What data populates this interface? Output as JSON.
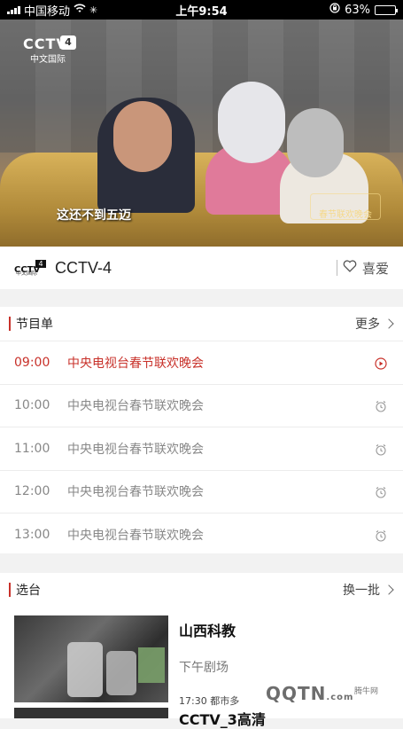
{
  "status_bar": {
    "carrier": "中国移动",
    "time": "上午9:54",
    "battery": "63%",
    "battery_level": 0.63
  },
  "video": {
    "channel_logo": "CCTV",
    "channel_number": "4",
    "channel_sub": "中文国际",
    "subtitle": "这还不到五迈",
    "stamp_text": "春节联欢晚会"
  },
  "channel_bar": {
    "logo_text": "CCTV",
    "logo_number": "4",
    "logo_sub": "中文国际",
    "name": "CCTV-4",
    "favorite_label": "喜爱"
  },
  "schedule": {
    "title": "节目单",
    "more_label": "更多",
    "items": [
      {
        "time": "09:00",
        "title": "中央电视台春节联欢晚会",
        "icon": "play-circle-icon",
        "active": true
      },
      {
        "time": "10:00",
        "title": "中央电视台春节联欢晚会",
        "icon": "alarm-icon",
        "active": false
      },
      {
        "time": "11:00",
        "title": "中央电视台春节联欢晚会",
        "icon": "alarm-icon",
        "active": false
      },
      {
        "time": "12:00",
        "title": "中央电视台春节联欢晚会",
        "icon": "alarm-icon",
        "active": false
      },
      {
        "time": "13:00",
        "title": "中央电视台春节联欢晚会",
        "icon": "alarm-icon",
        "active": false
      }
    ]
  },
  "channel_select": {
    "title": "选台",
    "refresh_label": "换一批",
    "items": [
      {
        "name": "山西科教",
        "show": "下午剧场",
        "next": "17:30 都市多"
      },
      {
        "name": "CCTV_3高清"
      }
    ]
  },
  "watermark": {
    "text": "QQTN",
    "suffix": ".com",
    "site_label": "腾牛网"
  },
  "colors": {
    "accent": "#c8312a",
    "muted_text": "#888888"
  }
}
